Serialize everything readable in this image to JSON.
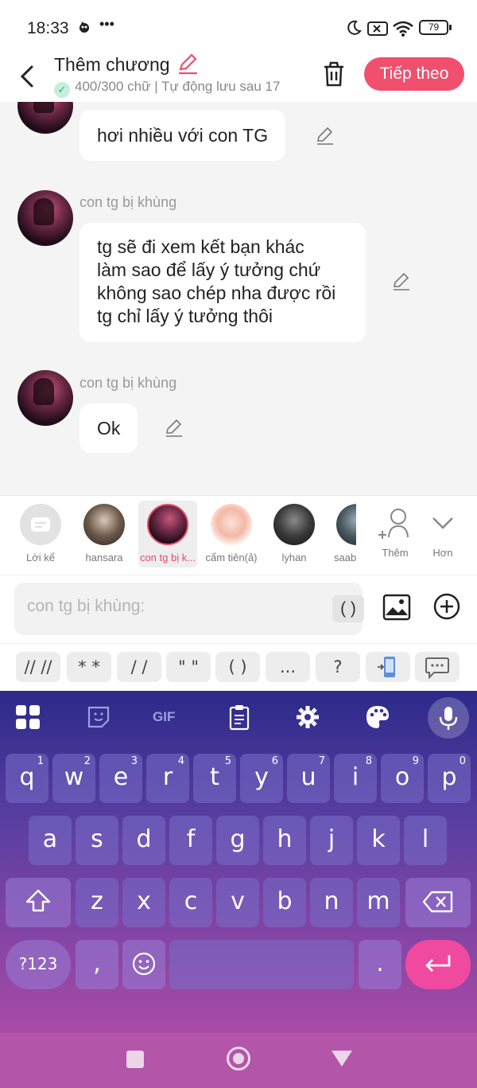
{
  "status": {
    "time": "18:33",
    "battery": "79"
  },
  "header": {
    "title": "Thêm chương",
    "subtitle": "400/300 chữ | Tự động lưu sau 17",
    "next_label": "Tiếp theo"
  },
  "messages": [
    {
      "sender": "",
      "lines": [
        "hơi nhiều với con TG"
      ]
    },
    {
      "sender": "con tg bị khùng",
      "lines": [
        "tg sẽ đi xem kết bạn khác",
        "làm sao để lấy ý tưởng chứ",
        "không sao chép nha được rồi",
        "tg chỉ lấy ý tưởng thôi"
      ]
    },
    {
      "sender": "con tg bị khùng",
      "lines": [
        "Ok"
      ]
    }
  ],
  "characters": [
    {
      "name": "Lời kể",
      "icon": "narrator-icon"
    },
    {
      "name": "hansara"
    },
    {
      "name": "con tg bị k...",
      "selected": true
    },
    {
      "name": "cẩm tiên(ả)"
    },
    {
      "name": "lyhan"
    },
    {
      "name": "saab"
    }
  ],
  "strip_actions": {
    "add_label": "Thêm",
    "more_label": "Hơn"
  },
  "input": {
    "placeholder": "con tg bị khùng:",
    "paren_label": "( )"
  },
  "punctuation": [
    "// //",
    "* *",
    "/ /",
    "\" \"",
    "( )",
    "...",
    "?"
  ],
  "keyboard": {
    "toolbar": [
      "apps-icon",
      "sticker-icon",
      "GIF",
      "clipboard-icon",
      "gear-icon",
      "palette-icon",
      "mic-icon"
    ],
    "row1": [
      [
        "q",
        "1"
      ],
      [
        "w",
        "2"
      ],
      [
        "e",
        "3"
      ],
      [
        "r",
        "4"
      ],
      [
        "t",
        "5"
      ],
      [
        "y",
        "6"
      ],
      [
        "u",
        "7"
      ],
      [
        "i",
        "8"
      ],
      [
        "o",
        "9"
      ],
      [
        "p",
        "0"
      ]
    ],
    "row2": [
      "a",
      "s",
      "d",
      "f",
      "g",
      "h",
      "j",
      "k",
      "l"
    ],
    "row3": [
      "z",
      "x",
      "c",
      "v",
      "b",
      "n",
      "m"
    ],
    "num_label": "?123",
    "comma": ",",
    "period": "."
  },
  "colors": {
    "accent": "#f0506e",
    "selected_text": "#e84a6a",
    "enter": "#f04aa0"
  }
}
